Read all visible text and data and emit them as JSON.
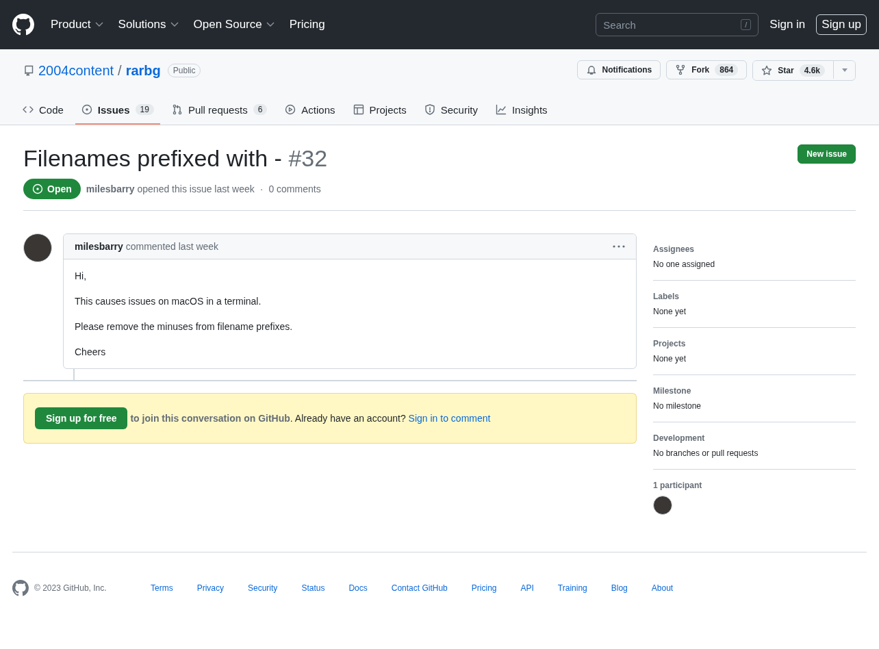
{
  "header": {
    "nav": [
      {
        "label": "Product",
        "dropdown": true
      },
      {
        "label": "Solutions",
        "dropdown": true
      },
      {
        "label": "Open Source",
        "dropdown": true
      },
      {
        "label": "Pricing",
        "dropdown": false
      }
    ],
    "search": {
      "placeholder": "Search",
      "shortcut": "/"
    },
    "sign_in": "Sign in",
    "sign_up": "Sign up"
  },
  "repo": {
    "owner": "2004content",
    "separator": "/",
    "name": "rarbg",
    "visibility": "Public",
    "actions": [
      {
        "kind": "notifications",
        "label": "Notifications"
      },
      {
        "kind": "fork",
        "label": "Fork",
        "count": "864"
      },
      {
        "kind": "star",
        "label": "Star",
        "count": "4.6k"
      }
    ]
  },
  "tabs": [
    {
      "kind": "code",
      "label": "Code",
      "selected": false
    },
    {
      "kind": "issues",
      "label": "Issues",
      "count": "19",
      "selected": true
    },
    {
      "kind": "pulls",
      "label": "Pull requests",
      "count": "6",
      "selected": false
    },
    {
      "kind": "actions",
      "label": "Actions",
      "selected": false
    },
    {
      "kind": "projects",
      "label": "Projects",
      "selected": false
    },
    {
      "kind": "security",
      "label": "Security",
      "selected": false
    },
    {
      "kind": "insights",
      "label": "Insights",
      "selected": false
    }
  ],
  "issue": {
    "title": "Filenames prefixed with -",
    "number": "#32",
    "state": "Open",
    "author": "milesbarry",
    "meta": "opened this issue last week",
    "separator": "·",
    "comments": "0 comments",
    "new_issue": "New issue"
  },
  "comment": {
    "author": "milesbarry",
    "meta": "commented last week",
    "body": [
      "Hi,",
      "This causes issues on macOS in a terminal.",
      "Please remove the minuses from filename prefixes.",
      "Cheers"
    ]
  },
  "signup_banner": {
    "button": "Sign up for free",
    "text": "**to join this conversation on GitHub**. Already have an account?",
    "link": "Sign in to comment"
  },
  "sidebar": [
    {
      "kind": "text",
      "heading": "Assignees",
      "value": "No one assigned"
    },
    {
      "kind": "text",
      "heading": "Labels",
      "value": "None yet"
    },
    {
      "kind": "text",
      "heading": "Projects",
      "value": "None yet"
    },
    {
      "kind": "text",
      "heading": "Milestone",
      "value": "No milestone"
    },
    {
      "kind": "text",
      "heading": "Development",
      "value": "No branches or pull requests"
    },
    {
      "kind": "avatars",
      "heading": "1 participant"
    }
  ],
  "footer": {
    "copyright": "© 2023 GitHub, Inc.",
    "links": [
      "Terms",
      "Privacy",
      "Security",
      "Status",
      "Docs",
      "Contact GitHub",
      "Pricing",
      "API",
      "Training",
      "Blog",
      "About"
    ]
  }
}
